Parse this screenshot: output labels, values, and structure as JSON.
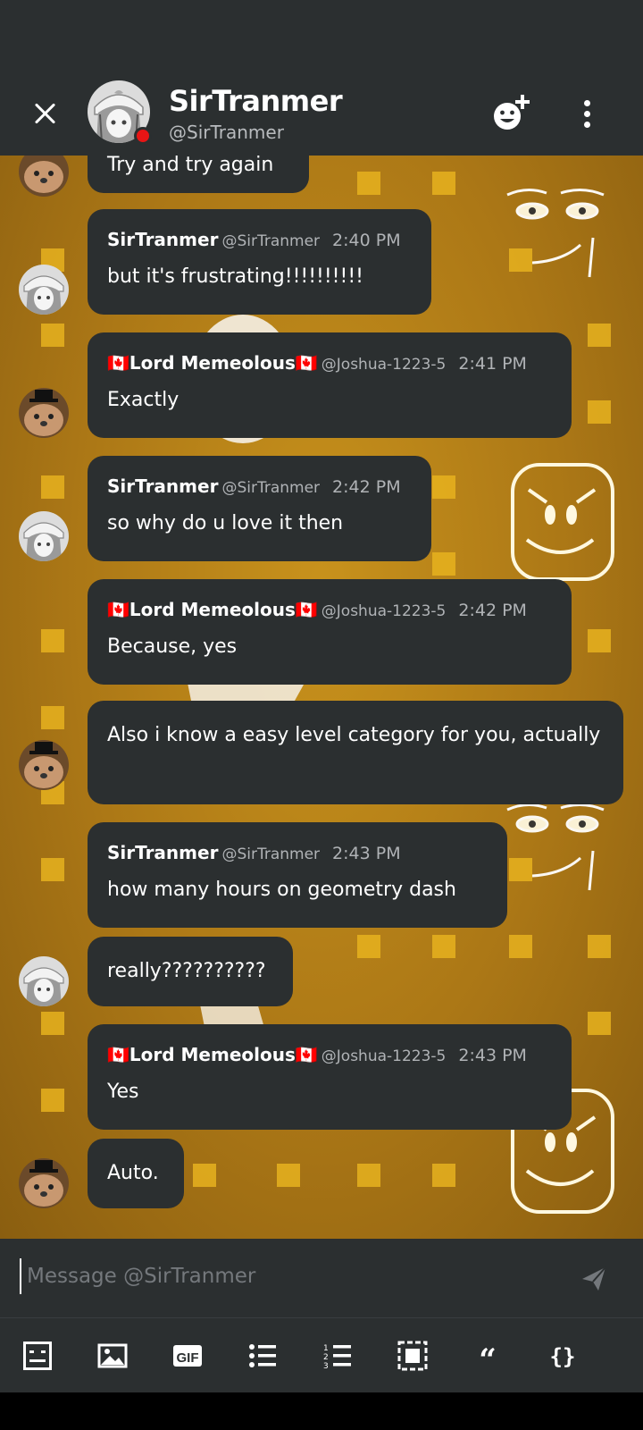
{
  "header": {
    "name": "SirTranmer",
    "handle": "@SirTranmer",
    "close_icon": "close-icon",
    "add_friend_icon": "add-friend-icon",
    "more_icon": "more-vertical-icon",
    "status_color": "#e81515"
  },
  "messages": [
    {
      "partial_text": "Try and try again"
    },
    {
      "author": "SirTranmer",
      "handle": "@SirTranmer",
      "time": "2:40 PM",
      "text": "but it's frustrating!!!!!!!!!!"
    },
    {
      "author": "🇨🇦Lord Memeolous🇨🇦",
      "handle": "@Joshua-1223-5",
      "time": "2:41 PM",
      "text": "Exactly"
    },
    {
      "author": "SirTranmer",
      "handle": "@SirTranmer",
      "time": "2:42 PM",
      "text": "so why do u love it then"
    },
    {
      "author": "🇨🇦Lord Memeolous🇨🇦",
      "handle": "@Joshua-1223-5",
      "time": "2:42 PM",
      "text": "Because, yes"
    },
    {
      "text": "Also i know a easy level category for you, actually"
    },
    {
      "author": "SirTranmer",
      "handle": "@SirTranmer",
      "time": "2:43 PM",
      "text": "how many hours on geometry dash"
    },
    {
      "text": "really??????????"
    },
    {
      "author": "🇨🇦Lord Memeolous🇨🇦",
      "handle": "@Joshua-1223-5",
      "time": "2:43 PM",
      "text": "Yes"
    },
    {
      "text": "Auto."
    }
  ],
  "composer": {
    "placeholder": "Message @SirTranmer",
    "send_icon": "send-icon"
  },
  "toolbar": {
    "gif_label": "GIF",
    "quote_label": "“",
    "code_label": "{}",
    "icons": [
      "emoji-icon",
      "image-icon",
      "gif-icon",
      "bulleted-list-icon",
      "numbered-list-icon",
      "spoiler-icon",
      "quote-icon",
      "code-block-icon"
    ]
  },
  "colors": {
    "bubble": "#2b2f30",
    "background": "#ab7716",
    "accent_square": "#e6b21f"
  }
}
